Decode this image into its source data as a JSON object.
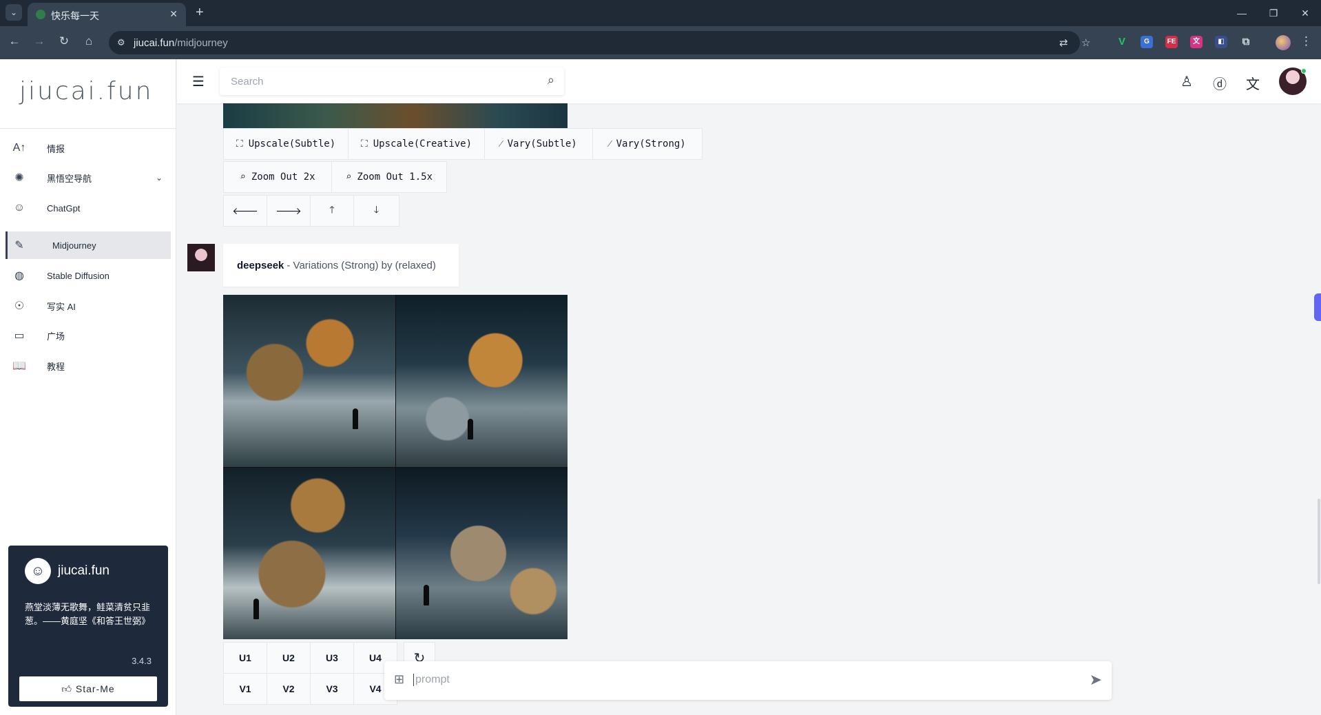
{
  "browser": {
    "tab_title": "快乐每一天",
    "url_host": "jiucai.fun",
    "url_path": "/midjourney",
    "extensions": [
      {
        "name": "vue-devtools-icon",
        "label": "V",
        "color": "#1f9d55"
      },
      {
        "name": "translate-ext-icon",
        "label": "G",
        "color": "#3b6fd8"
      },
      {
        "name": "fe-ext-icon",
        "label": "FE",
        "color": "#d62d48"
      },
      {
        "name": "ext-pink-icon",
        "label": "文",
        "color": "#d63384"
      },
      {
        "name": "ext-picker-icon",
        "label": "◧",
        "color": "#3a4e8c"
      }
    ]
  },
  "sidebar": {
    "logo": "jiucai.fun",
    "items": [
      {
        "label": "情报",
        "icon": "A↑"
      },
      {
        "label": "黑悟空导航",
        "icon": "✺"
      },
      {
        "label": "ChatGpt",
        "icon": "☺"
      },
      {
        "label": "Midjourney",
        "icon": "✎"
      },
      {
        "label": "Stable Diffusion",
        "icon": "◍"
      },
      {
        "label": "写实 AI",
        "icon": "☉"
      },
      {
        "label": "广场",
        "icon": "▭"
      },
      {
        "label": "教程",
        "icon": "📖"
      }
    ],
    "promo": {
      "name": "jiucai.fun",
      "poem": "燕堂淡薄无歌舞，鲑菜清贫只韭葱。——黄庭坚《和答王世弼》",
      "version": "3.4.3",
      "star_label": "Star-Me"
    }
  },
  "header": {
    "search_placeholder": "Search"
  },
  "prev_message": {
    "actions_row1": [
      {
        "label": "Upscale(Subtle)",
        "icon": "⛶"
      },
      {
        "label": "Upscale(Creative)",
        "icon": "⛶"
      },
      {
        "label": "Vary(Subtle)",
        "icon": "⁄"
      },
      {
        "label": "Vary(Strong)",
        "icon": "⁄"
      }
    ],
    "actions_row2": [
      {
        "label": "Zoom Out 2x",
        "icon": "⌕"
      },
      {
        "label": "Zoom Out 1.5x",
        "icon": "⌕"
      }
    ],
    "pan_arrows": [
      "🡐",
      "🡒",
      "🡑",
      "🡓"
    ]
  },
  "message": {
    "author": "deepseek",
    "text": "- Variations (Strong) by (relaxed)",
    "upscale_buttons": [
      "U1",
      "U2",
      "U3",
      "U4"
    ],
    "variation_buttons": [
      "V1",
      "V2",
      "V3",
      "V4"
    ]
  },
  "composer": {
    "placeholder": "prompt"
  }
}
